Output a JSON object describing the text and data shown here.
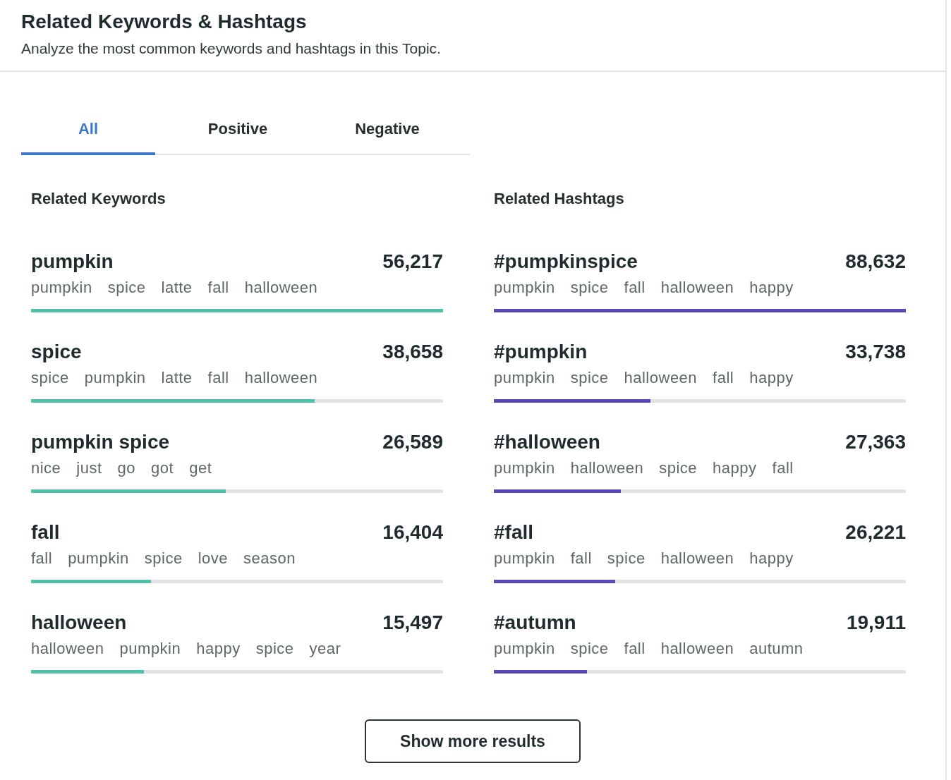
{
  "header": {
    "title": "Related Keywords & Hashtags",
    "subtitle": "Analyze the most common keywords and hashtags in this Topic."
  },
  "tabs": [
    {
      "label": "All",
      "selected": true
    },
    {
      "label": "Positive",
      "selected": false
    },
    {
      "label": "Negative",
      "selected": false
    }
  ],
  "sections": [
    {
      "heading": "Related Keywords",
      "color": "#4fc1a6",
      "items": [
        {
          "term": "pumpkin",
          "count": "56,217",
          "related": [
            "pumpkin",
            "spice",
            "latte",
            "fall",
            "halloween"
          ],
          "level": 1
        },
        {
          "term": "spice",
          "count": "38,658",
          "related": [
            "spice",
            "pumpkin",
            "latte",
            "fall",
            "halloween"
          ],
          "level": 0.688
        },
        {
          "term": "pumpkin spice",
          "count": "26,589",
          "related": [
            "nice",
            "just",
            "go",
            "got",
            "get"
          ],
          "level": 0.473
        },
        {
          "term": "fall",
          "count": "16,404",
          "related": [
            "fall",
            "pumpkin",
            "spice",
            "love",
            "season"
          ],
          "level": 0.291
        },
        {
          "term": "halloween",
          "count": "15,497",
          "related": [
            "halloween",
            "pumpkin",
            "happy",
            "spice",
            "year"
          ],
          "level": 0.274
        }
      ]
    },
    {
      "heading": "Related Hashtags",
      "color": "#5b46b8",
      "items": [
        {
          "term": "#pumpkinspice",
          "count": "88,632",
          "related": [
            "pumpkin",
            "spice",
            "fall",
            "halloween",
            "happy"
          ],
          "level": 1
        },
        {
          "term": "#pumpkin",
          "count": "33,738",
          "related": [
            "pumpkin",
            "spice",
            "halloween",
            "fall",
            "happy"
          ],
          "level": 0.38
        },
        {
          "term": "#halloween",
          "count": "27,363",
          "related": [
            "pumpkin",
            "halloween",
            "spice",
            "happy",
            "fall"
          ],
          "level": 0.308
        },
        {
          "term": "#fall",
          "count": "26,221",
          "related": [
            "pumpkin",
            "fall",
            "spice",
            "halloween",
            "happy"
          ],
          "level": 0.295
        },
        {
          "term": "#autumn",
          "count": "19,911",
          "related": [
            "pumpkin",
            "spice",
            "fall",
            "halloween",
            "autumn"
          ],
          "level": 0.226
        }
      ]
    }
  ],
  "button": "Show more results"
}
